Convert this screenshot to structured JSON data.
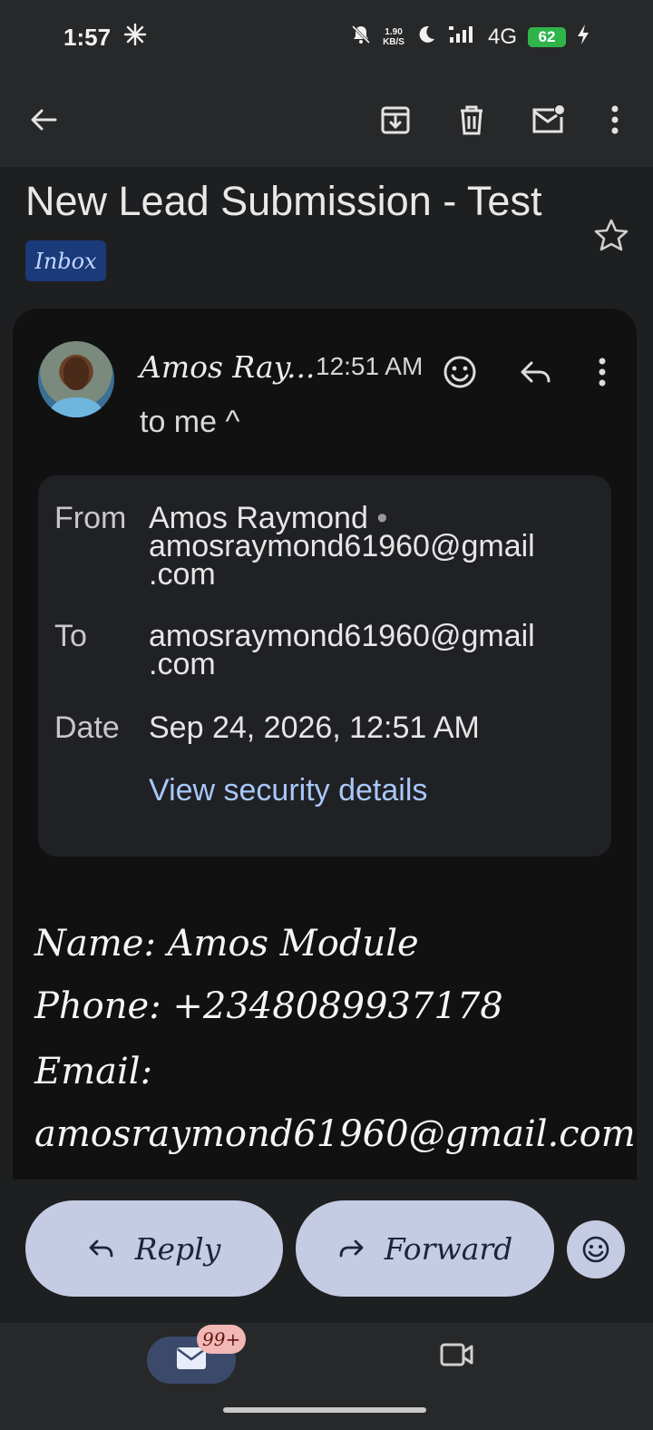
{
  "status_bar": {
    "time": "1:57",
    "net_speed_value": "1.90",
    "net_speed_unit": "KB/S",
    "network": "4G",
    "battery": "62"
  },
  "email": {
    "subject": "New Lead Submission - Test",
    "label": "Inbox",
    "sender_short": "Amos Ray...",
    "time": "12:51 AM",
    "to_line": "to me ^",
    "details": {
      "from_label": "From",
      "from_name": "Amos Raymond",
      "from_dot": "•",
      "from_email_line1": "amosraymond61960@gmail",
      "from_email_line2": ".com",
      "to_label": "To",
      "to_email_line1": "amosraymond61960@gmail",
      "to_email_line2": ".com",
      "date_label": "Date",
      "date_value": "Sep 24, 2026, 12:51 AM",
      "security_link": "View security details"
    },
    "body": {
      "name_line": "Name: Amos Module",
      "phone_line": "Phone: +2348089937178",
      "email_label": "Email:",
      "email_link": "amosraymond61960@gmail.com"
    }
  },
  "actions": {
    "reply": "Reply",
    "forward": "Forward"
  },
  "bottom_nav": {
    "mail_badge": "99+"
  },
  "colors": {
    "link": "#a8c7fa",
    "action_button": "#c5cbe3",
    "label_chip": "#1a3a7a"
  }
}
